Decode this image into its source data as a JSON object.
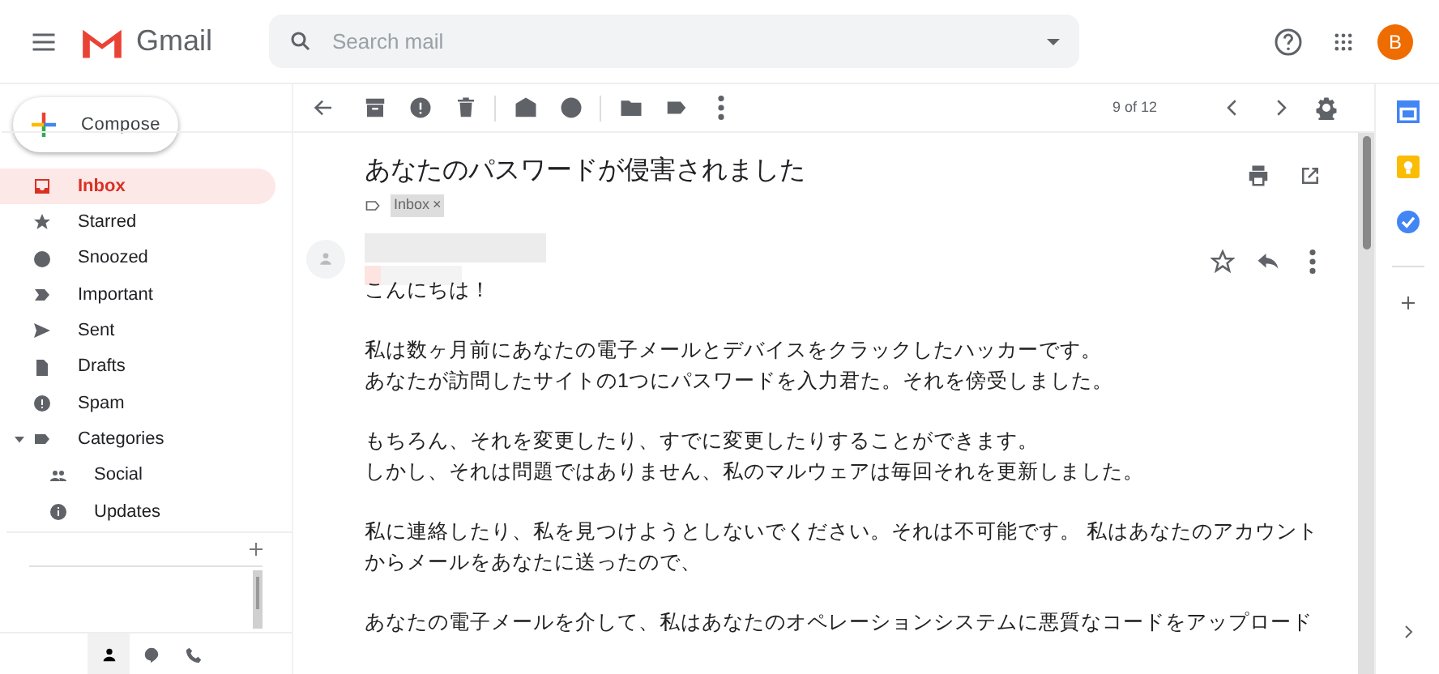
{
  "header": {
    "app_name": "Gmail",
    "search": {
      "placeholder": "Search mail"
    },
    "avatar": "B"
  },
  "compose": "Compose",
  "sidebar": {
    "items": [
      {
        "label": "Inbox",
        "selected": true
      },
      {
        "label": "Starred",
        "selected": false
      },
      {
        "label": "Snoozed",
        "selected": false
      },
      {
        "label": "Important",
        "selected": false
      },
      {
        "label": "Sent",
        "selected": false
      },
      {
        "label": "Drafts",
        "selected": false
      },
      {
        "label": "Spam",
        "selected": false
      },
      {
        "label": "Categories",
        "selected": false,
        "expanded": true,
        "children": [
          {
            "label": "Social",
            "selected": false
          },
          {
            "label": "Updates",
            "selected": false
          }
        ]
      }
    ]
  },
  "hangouts_tabs": [
    {
      "selected": true
    },
    {
      "selected": false
    },
    {
      "selected": false
    }
  ],
  "toolbar": {
    "counter": "9 of 12"
  },
  "message": {
    "subject": "あなたのパスワードが侵害されました",
    "labels": [
      {
        "label": "Inbox",
        "close": "×"
      }
    ],
    "body": [
      [
        "こんにちは！"
      ],
      [
        "私は数ヶ月前にあなたの電子メールとデバイスをクラックしたハッカーです。",
        "あなたが訪問したサイトの1つにパスワードを入力君た。それを傍受しました。"
      ],
      [
        "もちろん、それを変更したり、すでに変更したりすることができます。",
        "しかし、それは問題ではありません、私のマルウェアは毎回それを更新しました。"
      ],
      [
        "私に連絡したり、私を見つけようとしないでください。それは不可能です。 私はあなたのアカウント",
        "からメールをあなたに送ったので、"
      ],
      [
        "あなたの電子メールを介して、私はあなたのオペレーションシステムに悪質なコードをアップロード"
      ]
    ]
  }
}
